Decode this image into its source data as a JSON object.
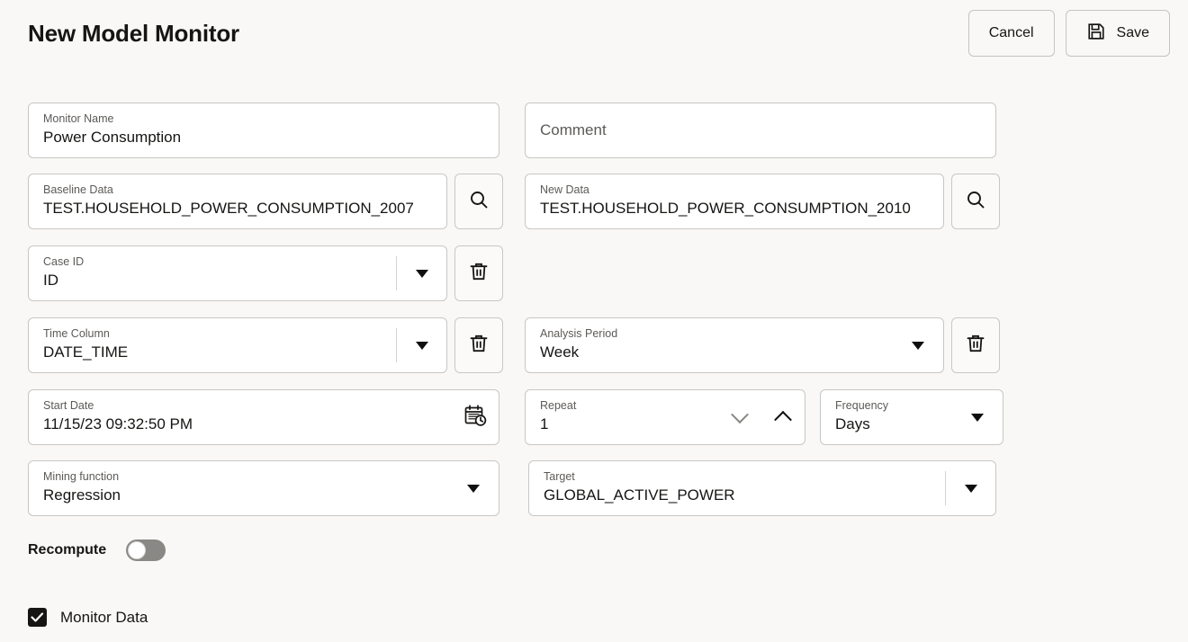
{
  "header": {
    "title": "New Model Monitor",
    "cancel_label": "Cancel",
    "save_label": "Save",
    "save_icon": "floppy-disk-icon"
  },
  "fields": {
    "monitor_name": {
      "label": "Monitor Name",
      "value": "Power Consumption"
    },
    "comment": {
      "placeholder": "Comment",
      "value": ""
    },
    "baseline_data": {
      "label": "Baseline Data",
      "value": "TEST.HOUSEHOLD_POWER_CONSUMPTION_2007",
      "action_icon": "search-icon"
    },
    "new_data": {
      "label": "New Data",
      "value": "TEST.HOUSEHOLD_POWER_CONSUMPTION_2010",
      "action_icon": "search-icon"
    },
    "case_id": {
      "label": "Case ID",
      "value": "ID",
      "action_icon": "trash-icon"
    },
    "time_column": {
      "label": "Time Column",
      "value": "DATE_TIME",
      "action_icon": "trash-icon"
    },
    "analysis_period": {
      "label": "Analysis Period",
      "value": "Week",
      "action_icon": "trash-icon"
    },
    "start_date": {
      "label": "Start Date",
      "value": "11/15/23 09:32:50 PM",
      "action_icon": "calendar-clock-icon"
    },
    "repeat": {
      "label": "Repeat",
      "value": "1",
      "down_icon": "chevron-down-icon",
      "up_icon": "chevron-up-icon"
    },
    "frequency": {
      "label": "Frequency",
      "value": "Days"
    },
    "mining_function": {
      "label": "Mining function",
      "value": "Regression"
    },
    "target": {
      "label": "Target",
      "value": "GLOBAL_ACTIVE_POWER"
    }
  },
  "controls": {
    "recompute_label": "Recompute",
    "recompute_on": false,
    "monitor_data_label": "Monitor Data",
    "monitor_data_checked": true
  },
  "colors": {
    "background": "#f9f8f7",
    "field_background": "#ffffff",
    "border": "#c8c7c6",
    "text": "#161513",
    "label_text": "#5c5a57",
    "toggle_off": "#8a8885"
  }
}
